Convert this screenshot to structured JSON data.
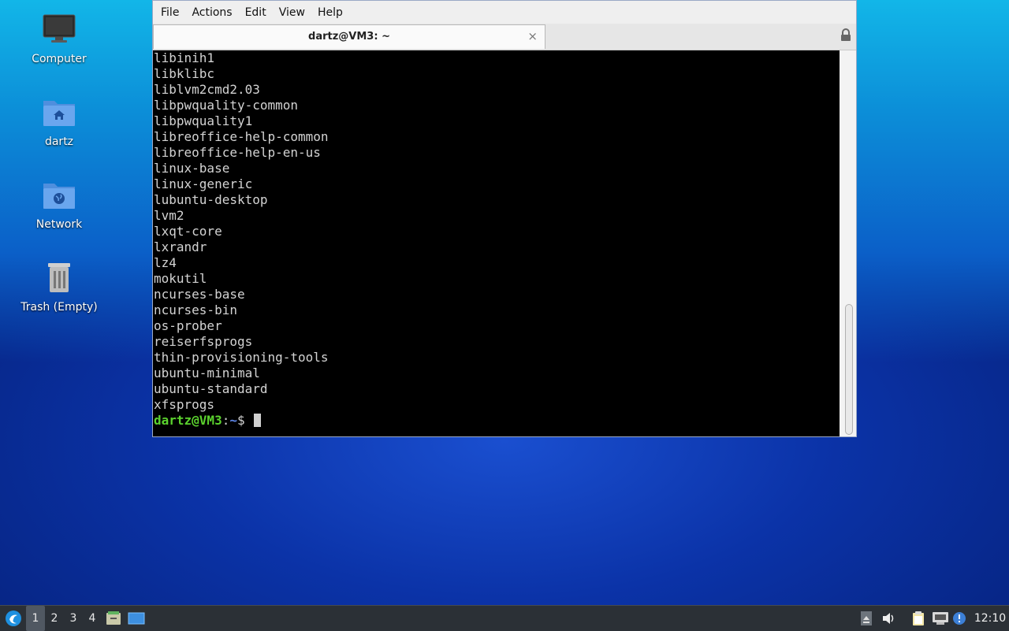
{
  "desktop": {
    "icons": [
      {
        "label": "Computer"
      },
      {
        "label": "dartz"
      },
      {
        "label": "Network"
      },
      {
        "label": "Trash (Empty)"
      }
    ]
  },
  "window": {
    "menu": [
      "File",
      "Actions",
      "Edit",
      "View",
      "Help"
    ],
    "tab_title": "dartz@VM3: ~",
    "tab_close": "×",
    "terminal": {
      "lines": [
        "libinih1",
        "libklibc",
        "liblvm2cmd2.03",
        "libpwquality-common",
        "libpwquality1",
        "libreoffice-help-common",
        "libreoffice-help-en-us",
        "linux-base",
        "linux-generic",
        "lubuntu-desktop",
        "lvm2",
        "lxqt-core",
        "lxrandr",
        "lz4",
        "mokutil",
        "ncurses-base",
        "ncurses-bin",
        "os-prober",
        "reiserfsprogs",
        "thin-provisioning-tools",
        "ubuntu-minimal",
        "ubuntu-standard",
        "xfsprogs"
      ],
      "prompt_user": "dartz@VM3",
      "prompt_sep": ":",
      "prompt_path": "~",
      "prompt_symbol": "$ "
    }
  },
  "taskbar": {
    "workspaces": [
      "1",
      "2",
      "3",
      "4"
    ],
    "active_workspace": "1",
    "clock": "12:10"
  },
  "colors": {
    "prompt_user": "#5bd22e",
    "prompt_path": "#5e86e8",
    "terminal_bg": "#000000",
    "taskbar_bg": "#2b3036"
  }
}
